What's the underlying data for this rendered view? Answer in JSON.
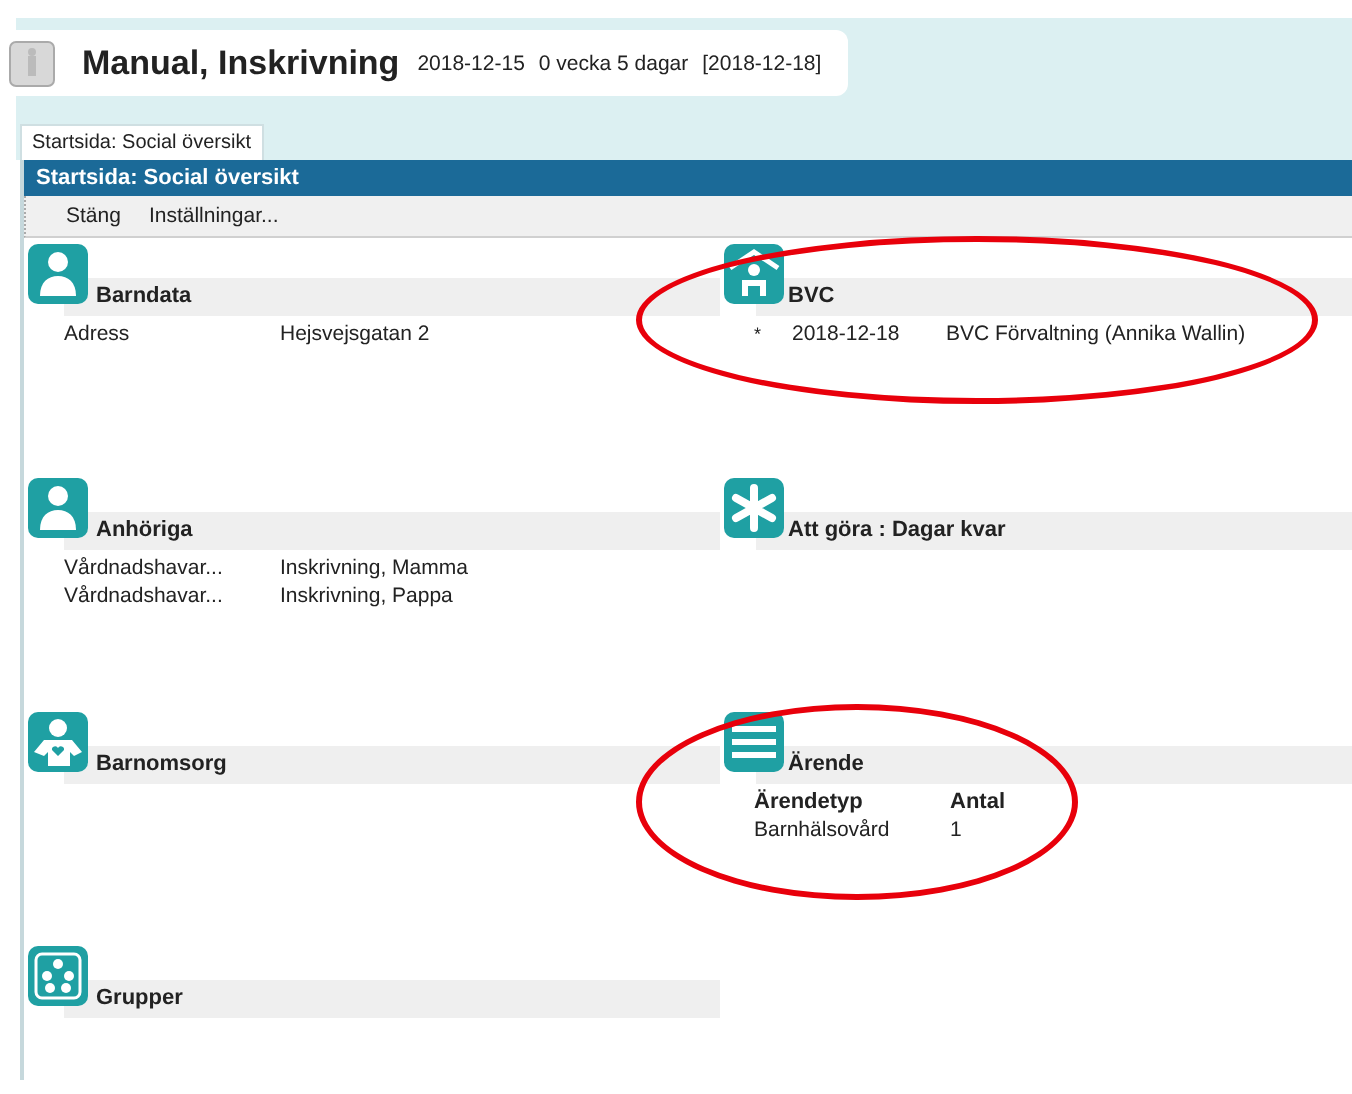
{
  "header": {
    "title": "Manual, Inskrivning",
    "date": "2018-12-15",
    "age": "0 vecka 5 dagar",
    "bracket_date": "[2018-12-18]"
  },
  "tabs": [
    {
      "label": "Startsida: Social översikt",
      "selected": true
    }
  ],
  "panel_title": "Startsida: Social översikt",
  "toolbar": [
    "Stäng",
    "Inställningar..."
  ],
  "panels": [
    {
      "title": "Barndata",
      "circled": false,
      "rows": [
        {
          "kind": "pair",
          "cells": [
            "Adress",
            "Hejsvejsgatan 2"
          ]
        }
      ]
    },
    {
      "title": "BVC",
      "circled": true,
      "rows": [
        {
          "kind": "bullet",
          "marker": "*",
          "cells": [
            "2018-12-18",
            "BVC Förvaltning (Annika Wallin)"
          ]
        }
      ]
    },
    {
      "title": "Anhöriga",
      "circled": false,
      "rows": [
        {
          "kind": "pair",
          "cells": [
            "Vårdnadshavar...",
            "Inskrivning, Mamma"
          ]
        },
        {
          "kind": "pair",
          "cells": [
            "Vårdnadshavar...",
            "Inskrivning, Pappa"
          ]
        }
      ]
    },
    {
      "title": "Att göra : Dagar kvar",
      "circled": false
    },
    {
      "title": "Barnomsorg",
      "circled": false
    },
    {
      "title": "Ärende",
      "circled": true,
      "rows": [
        {
          "kind": "header",
          "cells": [
            "Ärendetyp",
            "Antal"
          ]
        },
        {
          "kind": "pair",
          "cells": [
            "Barnhälsovård",
            "1"
          ]
        }
      ]
    },
    {
      "title": "Grupper",
      "circled": false
    }
  ]
}
